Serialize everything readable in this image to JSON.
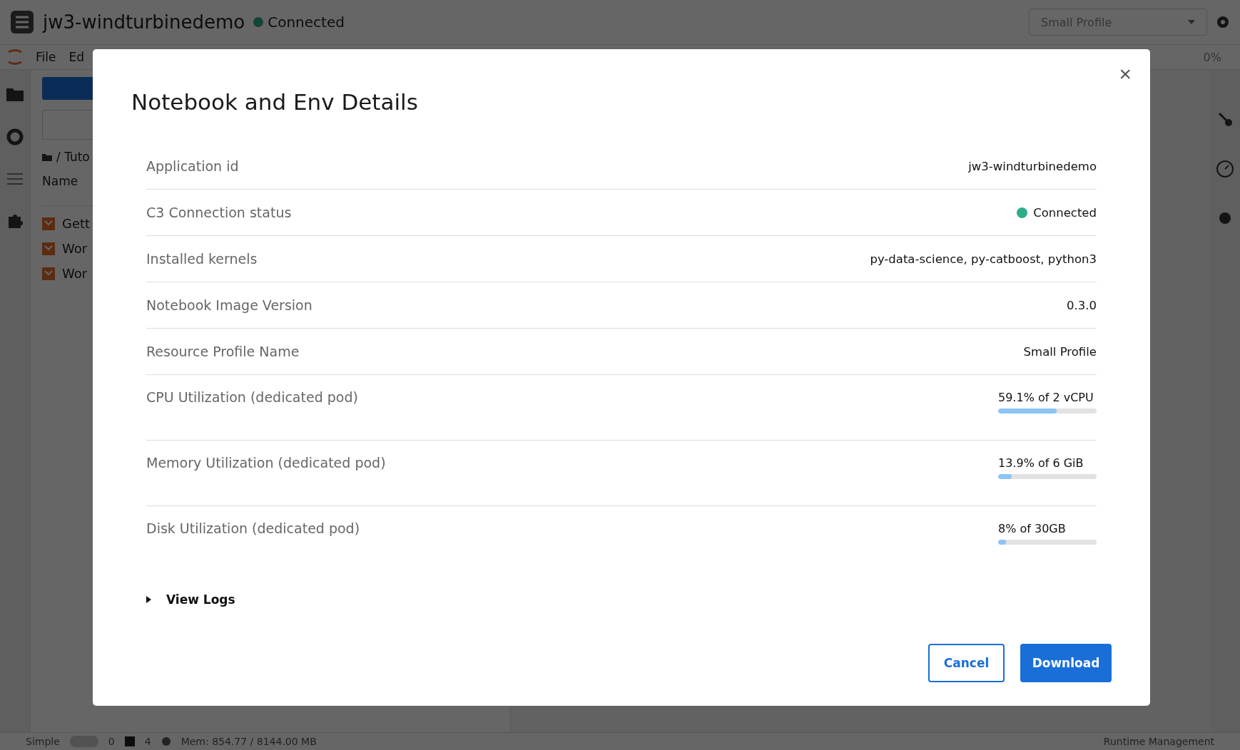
{
  "app": {
    "title": "jw3-windturbinedemo",
    "status": "Connected",
    "connected": true,
    "profile": "Small Profile",
    "menu": [
      "File",
      "Ed"
    ],
    "breadcrumb": "/ Tuto",
    "column": "Name",
    "files": [
      "Gett",
      "Wor",
      "Wor"
    ],
    "progress_text": "0%",
    "status_bar": {
      "mode": "Simple",
      "mode_on": false,
      "kernels": "0",
      "terminals": "4",
      "memory": "Mem: 854.77 / 8144.00 MB",
      "right": "Runtime Management"
    }
  },
  "dialog": {
    "title": "Notebook and Env Details",
    "close": "×",
    "rows": [
      {
        "kind": "text",
        "label": "Application id",
        "value": "jw3-windturbinedemo"
      },
      {
        "kind": "status",
        "label": "C3 Connection status",
        "value": "Connected",
        "connected": true
      },
      {
        "kind": "text",
        "label": "Installed kernels",
        "value": "py-data-science, py-catboost, python3"
      },
      {
        "kind": "text",
        "label": "Notebook Image Version",
        "value": "0.3.0"
      },
      {
        "kind": "text",
        "label": "Resource Profile Name",
        "value": "Small Profile"
      },
      {
        "kind": "meter",
        "label": "CPU Utilization (dedicated pod)",
        "value": "59.1% of 2 vCPU",
        "level": 0.591
      },
      {
        "kind": "meter",
        "label": "Memory Utilization (dedicated pod)",
        "value": "13.9% of 6 GiB",
        "level": 0.139
      },
      {
        "kind": "meter",
        "label": "Disk Utilization (dedicated pod)",
        "value": "8% of 30GB",
        "level": 0.08
      }
    ],
    "logs": {
      "label": "View Logs",
      "expanded": false
    },
    "buttons": [
      {
        "kind": "secondary",
        "label": "Cancel"
      },
      {
        "kind": "primary",
        "label": "Download"
      }
    ]
  }
}
